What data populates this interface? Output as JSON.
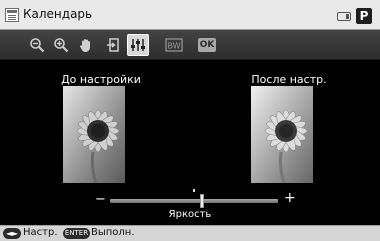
{
  "header": {
    "title": "Календарь",
    "mode_badge": "P"
  },
  "toolbar": {
    "buttons": [
      {
        "icon": "zoom-out-icon"
      },
      {
        "icon": "zoom-in-icon"
      },
      {
        "icon": "hand-pan-icon"
      },
      {
        "icon": "exit-icon"
      },
      {
        "icon": "adjust-icon",
        "active": true
      },
      {
        "icon": "black-white-icon"
      },
      {
        "icon": "ok-icon",
        "label": "OK"
      }
    ]
  },
  "preview": {
    "before_label": "До настройки",
    "after_label": "После настр."
  },
  "slider": {
    "label": "Яркость",
    "minus": "−",
    "plus": "+",
    "value_fraction": 0.55
  },
  "footer": {
    "nav_key": "◄►",
    "nav_hint": "Настр.",
    "enter_key": "ENTER",
    "enter_hint": "Выполн."
  },
  "colors": {
    "titlebar": "#e9e9e9",
    "toolbar": "#3a3a3a",
    "background": "#000000",
    "footer": "#d5d5d5"
  }
}
